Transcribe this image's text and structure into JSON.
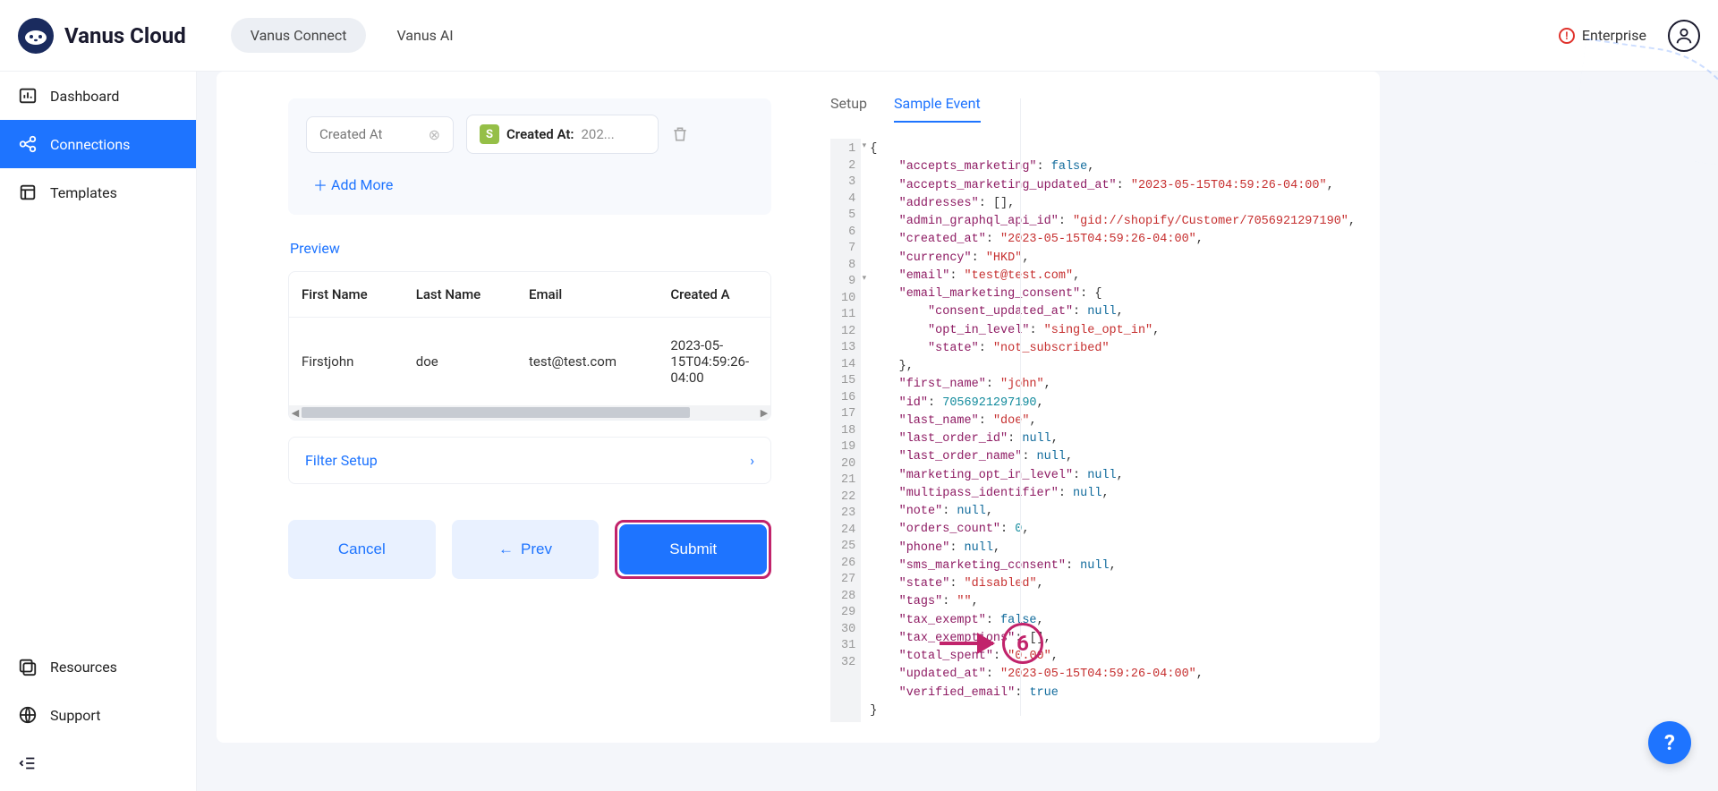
{
  "brand": "Vanus Cloud",
  "topTabs": {
    "connect": "Vanus Connect",
    "ai": "Vanus AI"
  },
  "headerRight": {
    "enterprise": "Enterprise"
  },
  "sidebar": {
    "dashboard": "Dashboard",
    "connections": "Connections",
    "templates": "Templates",
    "resources": "Resources",
    "support": "Support"
  },
  "mapRow": {
    "leftLabel": "Created At",
    "rightLabel": "Created At:",
    "rightValue": "202..."
  },
  "addMore": "Add More",
  "previewLabel": "Preview",
  "table": {
    "h1": "First Name",
    "h2": "Last Name",
    "h3": "Email",
    "h4": "Created A",
    "r1c1": "Firstjohn",
    "r1c2": "doe",
    "r1c3": "test@test.com",
    "r1c4": "2023-05-15T04:59:26-04:00"
  },
  "filterSetup": "Filter Setup",
  "buttons": {
    "cancel": "Cancel",
    "prev": "Prev",
    "submit": "Submit"
  },
  "stepNumber": "6",
  "rightTabs": {
    "setup": "Setup",
    "sample": "Sample Event"
  },
  "code": {
    "lines": [
      "1",
      "2",
      "3",
      "4",
      "5",
      "6",
      "7",
      "8",
      "9",
      "10",
      "11",
      "12",
      "13",
      "14",
      "15",
      "16",
      "17",
      "18",
      "19",
      "20",
      "21",
      "22",
      "23",
      "24",
      "25",
      "26",
      "27",
      "28",
      "29",
      "30",
      "31",
      "32"
    ],
    "json": {
      "accepts_marketing": false,
      "accepts_marketing_updated_at": "2023-05-15T04:59:26-04:00",
      "addresses": [],
      "admin_graphql_api_id": "gid://shopify/Customer/7056921297190",
      "created_at": "2023-05-15T04:59:26-04:00",
      "currency": "HKD",
      "email": "test@test.com",
      "email_marketing_consent": {
        "consent_updated_at": null,
        "opt_in_level": "single_opt_in",
        "state": "not_subscribed"
      },
      "first_name": "john",
      "id": 7056921297190,
      "last_name": "doe",
      "last_order_id": null,
      "last_order_name": null,
      "marketing_opt_in_level": null,
      "multipass_identifier": null,
      "note": null,
      "orders_count": 0,
      "phone": null,
      "sms_marketing_consent": null,
      "state": "disabled",
      "tags": "",
      "tax_exempt": false,
      "tax_exemptions": [],
      "total_spent": "0.00",
      "updated_at": "2023-05-15T04:59:26-04:00",
      "verified_email": true
    }
  },
  "fab": "?"
}
